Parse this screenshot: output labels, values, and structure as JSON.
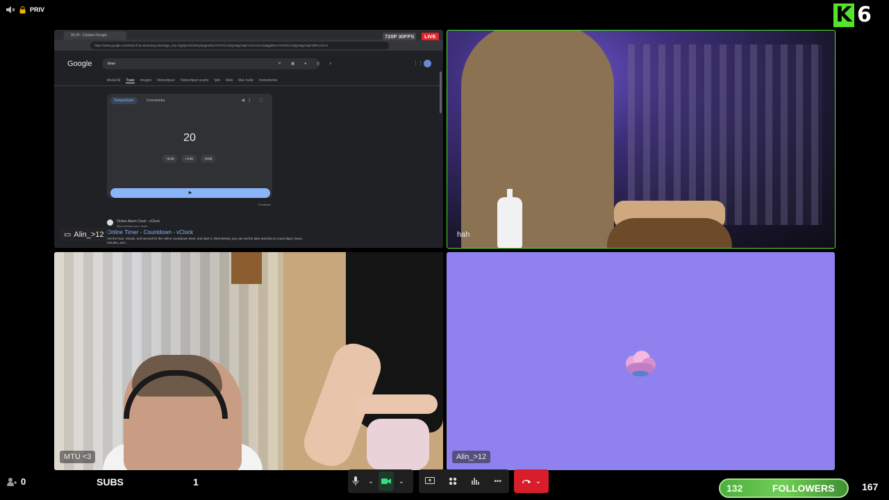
{
  "status": {
    "privacy_label": "PRIV"
  },
  "logo": {
    "letter": "K",
    "number": "6"
  },
  "tiles": {
    "screen": {
      "name": "Alin_>12",
      "badges": {
        "quality": "720P 30FPS",
        "live": "LIVE"
      },
      "browser": {
        "tab_title": "00:20 - Căutare Google",
        "url": "https://www.google.com/search?q=timer&oq=timer&gs_lcrp=EgZjaHJvbWUyDwgAEEUYOTIGCAEQABgAMgYIAhAAGAAyBggDEAAYADIGCAQQABgAMgYIBRAAGAA",
        "google_logo": "Google",
        "search_query": "timer",
        "nav": [
          "Modul AI",
          "Toate",
          "Imagini",
          "Videoclipuri",
          "Videoclipuri scurte",
          "Știri",
          "Web",
          "Mai multe",
          "Instrumente"
        ],
        "active_nav": "Toate",
        "timer": {
          "chip_active": "Temporizator",
          "chip_other": "Cronometru",
          "value": "20",
          "adds": [
            "+0:30",
            "+1:00",
            "+5:00"
          ],
          "feedback": "Feedback"
        },
        "result": {
          "site": "Online Alarm Clock - vClock",
          "url": "https://vclock.com › timer",
          "title": "Online Timer - Countdown - vClock",
          "desc": "Set the hour, minute, and second for the online countdown timer, and start it. Alternatively, you can set the date and time to count days, hours, minutes, and ..."
        }
      }
    },
    "cam_top_right": {
      "name": "hah"
    },
    "cam_bottom_left": {
      "name": "MTU <3"
    },
    "cam_bottom_right": {
      "name": "Alin_>12"
    }
  },
  "bottom": {
    "viewers": "0",
    "subs_label": "SUBS",
    "subs_count": "1",
    "followers": {
      "current": "132",
      "label": "FOLLOWERS",
      "goal": "167",
      "progress": 0.79
    }
  },
  "colors": {
    "accent": "#52e52b",
    "live": "#e2232b",
    "hangup": "#d81e2a",
    "tile_bg": "#8f82ee"
  }
}
